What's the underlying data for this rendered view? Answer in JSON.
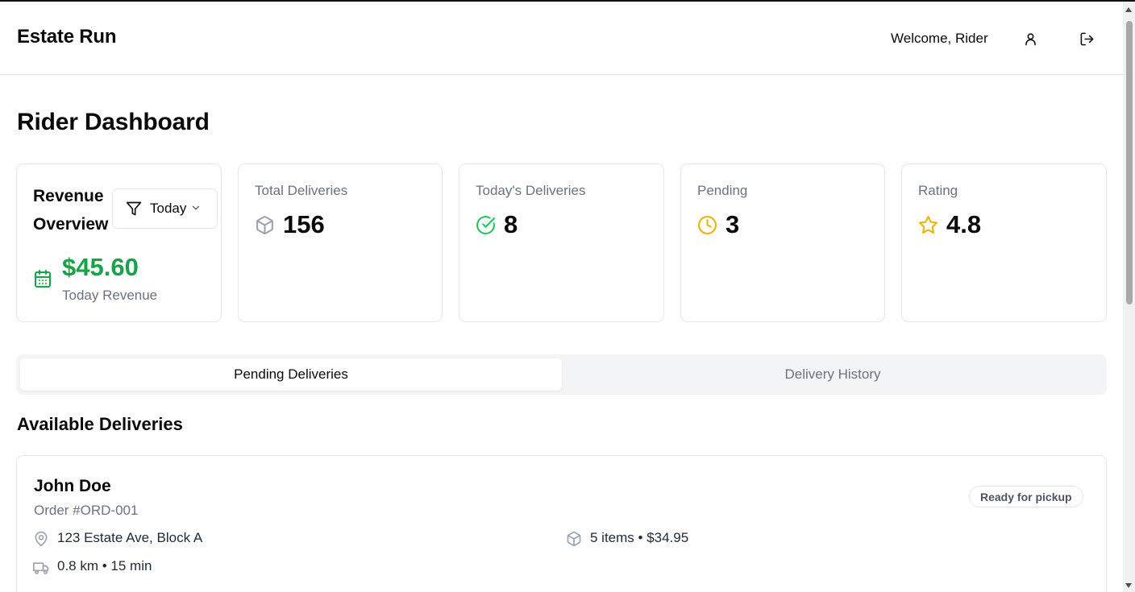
{
  "header": {
    "brand": "Estate Run",
    "welcome": "Welcome, Rider",
    "profile_icon": "user-icon",
    "logout_icon": "logout-icon"
  },
  "page": {
    "title": "Rider Dashboard"
  },
  "revenue": {
    "title": "Revenue Overview",
    "filter_label": "Today",
    "amount": "$45.60",
    "subtitle": "Today Revenue",
    "amount_color": "#16a34a",
    "icon": "calendar-icon"
  },
  "stats": [
    {
      "label": "Total Deliveries",
      "value": "156",
      "icon": "package-icon",
      "color": "#9ca3af"
    },
    {
      "label": "Today's Deliveries",
      "value": "8",
      "icon": "check-circle-icon",
      "color": "#22c55e"
    },
    {
      "label": "Pending",
      "value": "3",
      "icon": "clock-icon",
      "color": "#eab308"
    },
    {
      "label": "Rating",
      "value": "4.8",
      "icon": "star-icon",
      "color": "#eab308"
    }
  ],
  "tabs": [
    {
      "label": "Pending Deliveries",
      "active": true
    },
    {
      "label": "Delivery History",
      "active": false
    }
  ],
  "available": {
    "title": "Available Deliveries",
    "orders": [
      {
        "customer": "John Doe",
        "order_no": "Order #ORD-001",
        "status": "Ready for pickup",
        "address": "123 Estate Ave, Block A",
        "items": "5 items • $34.95",
        "distance": "0.8 km • 15 min"
      }
    ]
  }
}
